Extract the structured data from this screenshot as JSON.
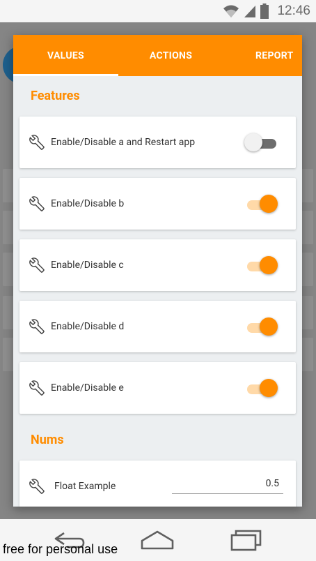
{
  "status_bar": {
    "time": "12:46",
    "icons": [
      "wifi-icon",
      "signal-icon",
      "battery-icon"
    ]
  },
  "dialog": {
    "tabs": [
      {
        "label": "VALUES",
        "selected": true
      },
      {
        "label": "ACTIONS",
        "selected": false
      },
      {
        "label": "REPORT",
        "selected": false
      }
    ],
    "sections": {
      "features": {
        "title": "Features",
        "items": [
          {
            "label": "Enable/Disable a and Restart app",
            "enabled": false
          },
          {
            "label": "Enable/Disable b",
            "enabled": true
          },
          {
            "label": "Enable/Disable c",
            "enabled": true
          },
          {
            "label": "Enable/Disable d",
            "enabled": true
          },
          {
            "label": "Enable/Disable e",
            "enabled": true
          }
        ]
      },
      "nums": {
        "title": "Nums",
        "items": [
          {
            "label": "Float Example",
            "value": "0.5"
          }
        ]
      }
    }
  },
  "nav_bar": {
    "buttons": [
      "back-icon",
      "home-icon",
      "recents-icon"
    ]
  },
  "watermark": "free for personal use",
  "colors": {
    "accent": "#ff8c00",
    "track_on": "#ffd9a8",
    "dialog_bg": "#eceff1"
  }
}
